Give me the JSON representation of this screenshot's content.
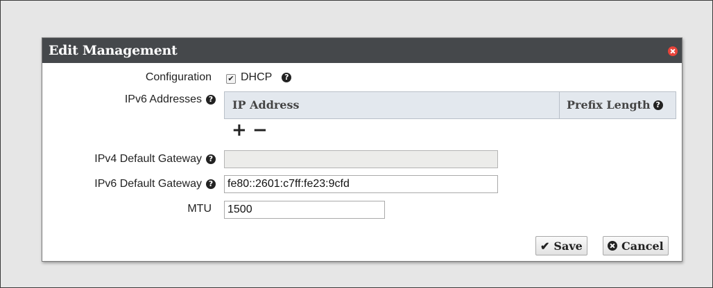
{
  "dialog": {
    "title": "Edit Management",
    "close_icon": "close-icon"
  },
  "form": {
    "configuration_label": "Configuration",
    "dhcp_label": "DHCP",
    "dhcp_checked": true,
    "ipv6_addresses_label": "IPv6 Addresses",
    "table_headers": [
      "IP Address",
      "Prefix Length"
    ],
    "add_symbol": "+",
    "remove_symbol": "−",
    "ipv4_gateway_label": "IPv4 Default Gateway",
    "ipv4_gateway_value": "",
    "ipv6_gateway_label": "IPv6 Default Gateway",
    "ipv6_gateway_value": "fe80::2601:c7ff:fe23:9cfd",
    "mtu_label": "MTU",
    "mtu_value": "1500",
    "help_glyph": "?"
  },
  "buttons": {
    "save_label": "Save",
    "save_icon": "✔",
    "cancel_label": "Cancel"
  },
  "colors": {
    "titlebar": "#45484b",
    "close": "#e8443a",
    "table_header_bg": "#e3e8ee"
  }
}
